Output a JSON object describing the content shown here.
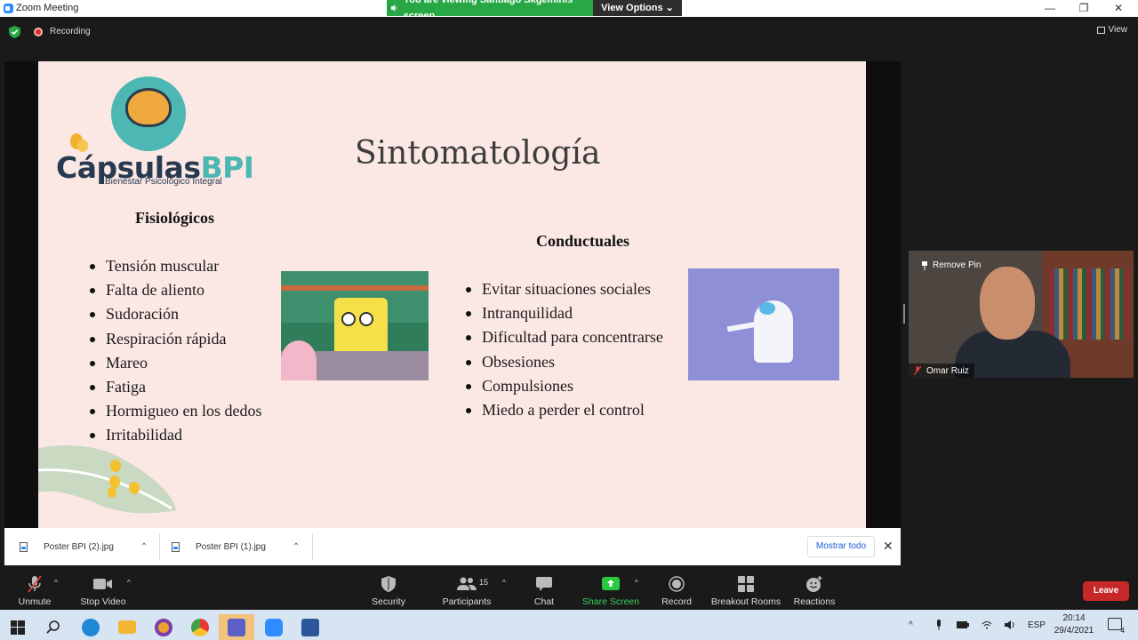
{
  "window": {
    "title": "Zoom Meeting",
    "viewing_banner": "You are viewing Santiago Skgeminis' screen",
    "view_options": "View Options",
    "minimize": "—",
    "restore": "❐",
    "close": "✕"
  },
  "topbar": {
    "recording": "Recording",
    "view": "View"
  },
  "slide": {
    "logo_name_main": "Cápsulas",
    "logo_name_accent": "BPI",
    "logo_tagline": "Bienestar Psicológico Integral",
    "title": "Sintomatología",
    "col1_heading": "Fisiológicos",
    "col1_items": [
      "Tensión muscular",
      "Falta de aliento",
      "Sudoración",
      "Respiración rápida",
      "Mareo",
      "Fatiga",
      "Hormigueo en los dedos",
      "Irritabilidad"
    ],
    "col2_heading": "Conductuales",
    "col2_items": [
      "Evitar situaciones sociales",
      "Intranquilidad",
      "Dificultad para concentrarse",
      "Obsesiones",
      "Compulsiones",
      "Miedo a perder el control"
    ]
  },
  "downloads": {
    "items": [
      {
        "name": "Poster BPI (2).jpg"
      },
      {
        "name": "Poster BPI (1).jpg"
      }
    ],
    "show_all": "Mostrar todo",
    "close": "✕"
  },
  "participant": {
    "pin_label": "Remove Pin",
    "name": "Omar Ruiz"
  },
  "toolbar": {
    "unmute": "Unmute",
    "stop_video": "Stop Video",
    "security": "Security",
    "participants": "Participants",
    "participants_count": "15",
    "chat": "Chat",
    "share_screen": "Share Screen",
    "record": "Record",
    "breakout_rooms": "Breakout Rooms",
    "reactions": "Reactions",
    "leave": "Leave",
    "caret": "^"
  },
  "taskbar": {
    "lang": "ESP",
    "time": "20:14",
    "date": "29/4/2021",
    "notif_count": "4"
  },
  "colors": {
    "accent_green": "#28a745",
    "leave_red": "#c62828",
    "slide_bg": "#fbe8e4",
    "logo_teal": "#4cb7b3"
  }
}
